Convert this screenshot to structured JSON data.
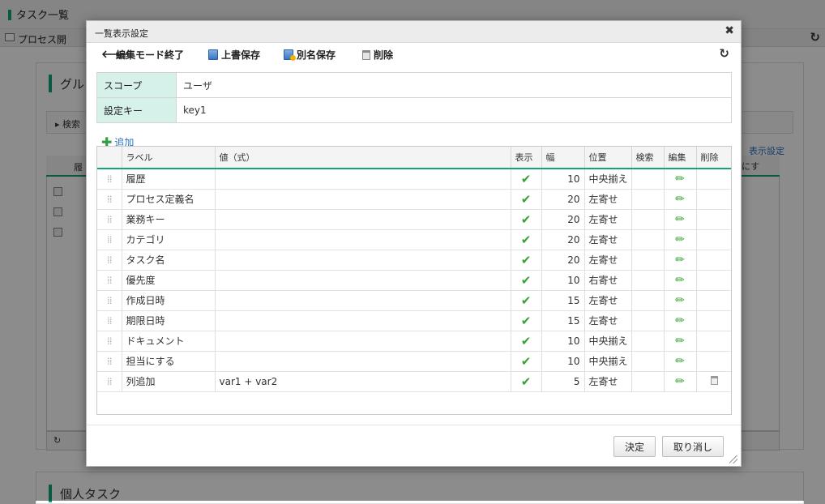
{
  "background": {
    "page_title": "タスク一覧",
    "process_label": "プロセス開",
    "panel_title": "グル",
    "search_label": "▸ 検索",
    "display_settings_link": "表示設定",
    "column_fragment": "にす",
    "head_fragment": "履",
    "panel2_title": "個人タスク"
  },
  "dialog": {
    "title": "一覧表示設定",
    "toolbar": {
      "end_edit": "編集モード終了",
      "overwrite_save": "上書保存",
      "save_as": "別名保存",
      "delete": "削除"
    },
    "scope": {
      "label": "スコープ",
      "value": "ユーザ"
    },
    "setting_key": {
      "label": "設定キー",
      "value": "key1"
    },
    "add_link": "追加",
    "columns": {
      "label": "ラベル",
      "value": "値（式）",
      "display": "表示",
      "width": "幅",
      "position": "位置",
      "search": "検索",
      "edit": "編集",
      "delete": "削除"
    },
    "rows": [
      {
        "label": "履歴",
        "value": "",
        "width": "10",
        "position": "中央揃え"
      },
      {
        "label": "プロセス定義名",
        "value": "",
        "width": "20",
        "position": "左寄せ"
      },
      {
        "label": "業務キー",
        "value": "",
        "width": "20",
        "position": "左寄せ"
      },
      {
        "label": "カテゴリ",
        "value": "",
        "width": "20",
        "position": "左寄せ"
      },
      {
        "label": "タスク名",
        "value": "",
        "width": "20",
        "position": "左寄せ"
      },
      {
        "label": "優先度",
        "value": "",
        "width": "10",
        "position": "右寄せ"
      },
      {
        "label": "作成日時",
        "value": "",
        "width": "15",
        "position": "左寄せ"
      },
      {
        "label": "期限日時",
        "value": "",
        "width": "15",
        "position": "左寄せ"
      },
      {
        "label": "ドキュメント",
        "value": "",
        "width": "10",
        "position": "中央揃え"
      },
      {
        "label": "担当にする",
        "value": "",
        "width": "10",
        "position": "中央揃え"
      },
      {
        "label": "列追加",
        "value": "var1 + var2",
        "width": "5",
        "position": "左寄せ"
      }
    ],
    "ok_button": "決定",
    "cancel_button": "取り消し"
  }
}
